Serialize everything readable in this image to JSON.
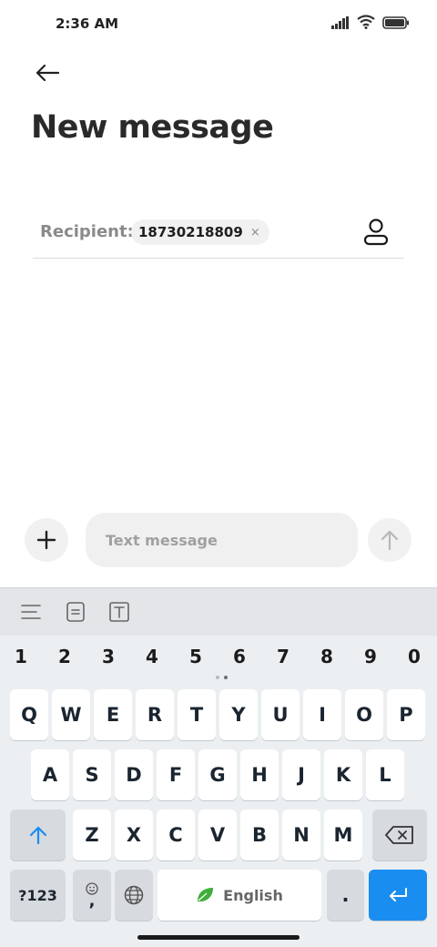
{
  "status_bar": {
    "time": "2:36 AM"
  },
  "header": {
    "title": "New message"
  },
  "recipient": {
    "label": "Recipient:",
    "chips": [
      {
        "number": "18730218809",
        "remove_label": "×"
      }
    ]
  },
  "compose": {
    "placeholder": "Text message",
    "value": ""
  },
  "keyboard": {
    "numbers": [
      "1",
      "2",
      "3",
      "4",
      "5",
      "6",
      "7",
      "8",
      "9",
      "0"
    ],
    "row1": [
      "Q",
      "W",
      "E",
      "R",
      "T",
      "Y",
      "U",
      "I",
      "O",
      "P"
    ],
    "row2": [
      "A",
      "S",
      "D",
      "F",
      "G",
      "H",
      "J",
      "K",
      "L"
    ],
    "row3": [
      "Z",
      "X",
      "C",
      "V",
      "B",
      "N",
      "M"
    ],
    "symbols_label": "?123",
    "comma_label": ",",
    "space_label": "English",
    "period_label": ".",
    "colors": {
      "enter": "#1a8df0",
      "shift": "#1a8df0",
      "leaf": "#3fae3a"
    }
  }
}
